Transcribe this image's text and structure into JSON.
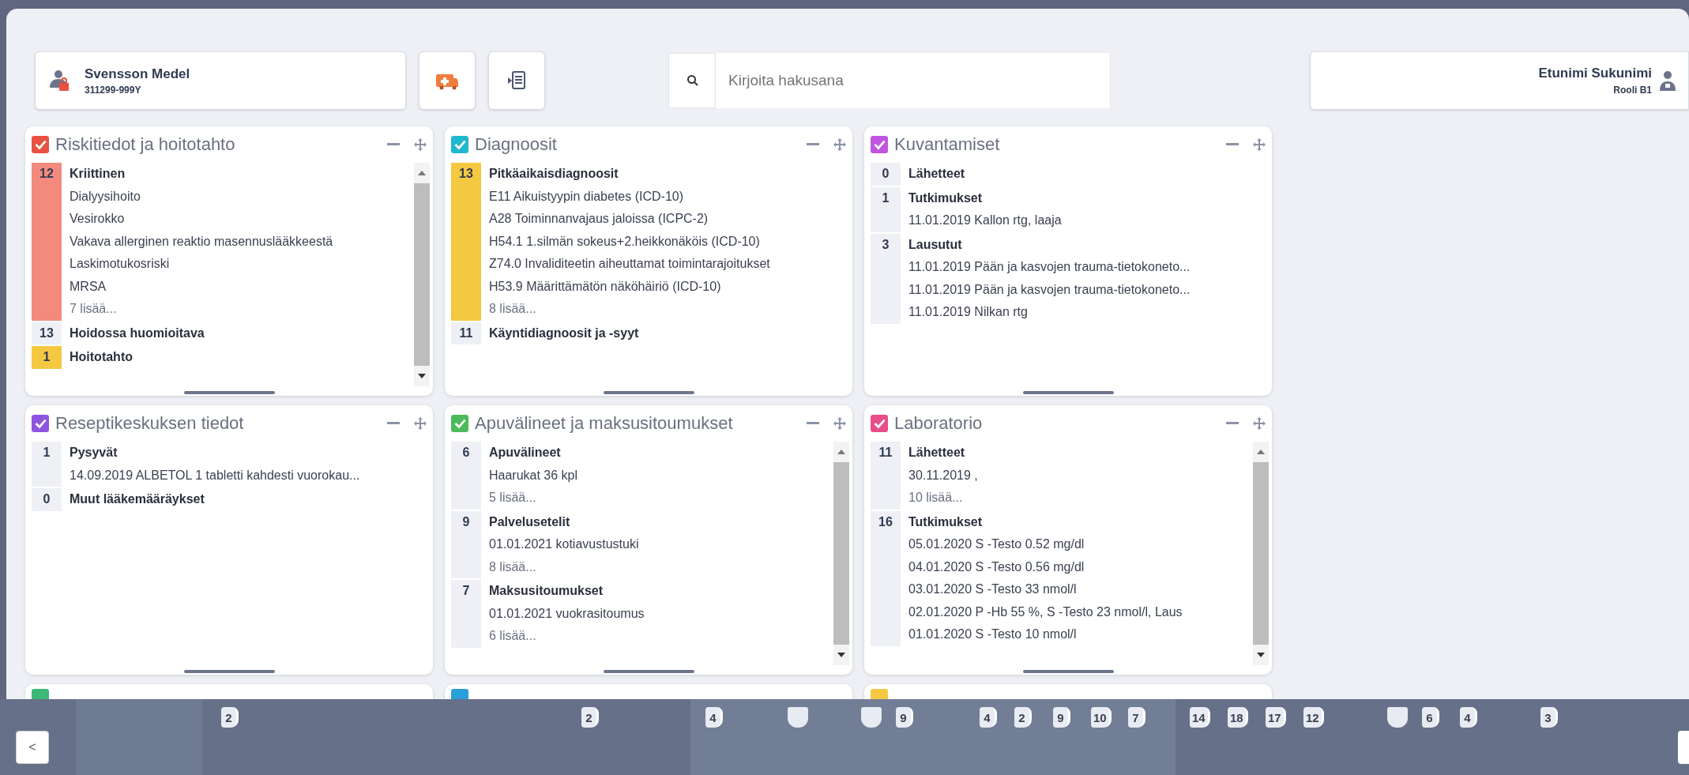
{
  "patient": {
    "name": "Svensson Medel",
    "id": "311299-999Y"
  },
  "search": {
    "placeholder": "Kirjoita hakusana"
  },
  "user": {
    "name": "Etunimi Sukunimi",
    "role": "Rooli B1"
  },
  "panels": [
    {
      "title": "Riskitiedot ja hoitotahto",
      "color": "#e8513f",
      "scroll": true,
      "groups": [
        {
          "count": "12",
          "color": "#f28b7e",
          "title": "Kriittinen",
          "items": [
            "Dialyysihoito",
            "Vesirokko",
            "Vakava allerginen reaktio masennuslääkkeestä",
            "Laskimotukosriski",
            "MRSA"
          ],
          "more": "7 lisää..."
        },
        {
          "count": "13",
          "color": "#eef0f5",
          "title": "Hoidossa huomioitava"
        },
        {
          "count": "1",
          "color": "#f5c842",
          "title": "Hoitotahto"
        }
      ]
    },
    {
      "title": "Diagnoosit",
      "color": "#20b8cf",
      "scroll": false,
      "groups": [
        {
          "count": "13",
          "color": "#f5c842",
          "title": "Pitkäaikaisdiagnoosit",
          "items": [
            "E11 Aikuistyypin diabetes (ICD-10)",
            "A28 Toiminnanvajaus jaloissa (ICPC-2)",
            "H54.1 1.silmän sokeus+2.heikkonäköis (ICD-10)",
            "Z74.0 Invaliditeetin aiheuttamat toimintarajoitukset",
            "H53.9 Määrittämätön näköhäiriö (ICD-10)"
          ],
          "more": "8 lisää..."
        },
        {
          "count": "11",
          "color": "#eef0f5",
          "title": "Käyntidiagnoosit ja -syyt"
        }
      ]
    },
    {
      "title": "Kuvantamiset",
      "color": "#c055e0",
      "scroll": false,
      "groups": [
        {
          "count": "0",
          "color": "#eef0f5",
          "title": "Lähetteet"
        },
        {
          "count": "1",
          "color": "#eef0f5",
          "title": "Tutkimukset",
          "items": [
            "11.01.2019 Kallon rtg, laaja"
          ]
        },
        {
          "count": "3",
          "color": "#eef0f5",
          "title": "Lausutut",
          "items": [
            "11.01.2019 Pään ja kasvojen trauma-tietokoneto...",
            "11.01.2019 Pään ja kasvojen trauma-tietokoneto...",
            "11.01.2019 Nilkan rtg"
          ]
        }
      ]
    },
    {
      "title": "Reseptikeskuksen tiedot",
      "color": "#8e54e0",
      "scroll": false,
      "groups": [
        {
          "count": "1",
          "color": "#eef0f5",
          "title": "Pysyvät",
          "items": [
            "14.09.2019 ALBETOL 1 tabletti kahdesti vuorokau..."
          ]
        },
        {
          "count": "0",
          "color": "#eef0f5",
          "title": "Muut lääkemääräykset"
        }
      ]
    },
    {
      "title": "Apuvälineet ja maksusitoumukset",
      "color": "#4cba5a",
      "scroll": true,
      "groups": [
        {
          "count": "6",
          "color": "#eef0f5",
          "title": "Apuvälineet",
          "items": [
            "Haarukat 36 kpl"
          ],
          "more": "5 lisää..."
        },
        {
          "count": "9",
          "color": "#eef0f5",
          "title": "Palvelusetelit",
          "items": [
            "01.01.2021 kotiavustustuki"
          ],
          "more": "8 lisää..."
        },
        {
          "count": "7",
          "color": "#eef0f5",
          "title": "Maksusitoumukset",
          "items": [
            "01.01.2021 vuokrasitoumus"
          ],
          "more": "6 lisää..."
        }
      ]
    },
    {
      "title": "Laboratorio",
      "color": "#e84d8a",
      "scroll": true,
      "groups": [
        {
          "count": "11",
          "color": "#eef0f5",
          "title": "Lähetteet",
          "items": [
            "30.11.2019 ,"
          ],
          "more": "10 lisää..."
        },
        {
          "count": "16",
          "color": "#eef0f5",
          "title": "Tutkimukset",
          "items": [
            "05.01.2020 S -Testo 0.52 mg/dl",
            "04.01.2020 S -Testo 0.56 mg/dl",
            "03.01.2020 S -Testo 33 nmol/l",
            "02.01.2020 P -Hb 55 %, S -Testo 23 nmol/l, Laus",
            "01.01.2020 S -Testo 10 nmol/l"
          ]
        }
      ]
    }
  ],
  "hidden_panels": [
    {
      "color": "#3cb878"
    },
    {
      "color": "#2a9fd8"
    },
    {
      "color": "#f5c842"
    }
  ],
  "timeline": {
    "back": "<",
    "markers": [
      {
        "kind": "count",
        "label": "2"
      },
      {
        "kind": "count",
        "label": "2"
      },
      {
        "kind": "count",
        "label": "4"
      },
      {
        "kind": "empty"
      },
      {
        "kind": "empty"
      },
      {
        "kind": "count",
        "label": "9"
      },
      {
        "kind": "count",
        "label": "4"
      },
      {
        "kind": "count",
        "label": "2"
      },
      {
        "kind": "count",
        "label": "9"
      },
      {
        "kind": "count",
        "label": "10"
      },
      {
        "kind": "count",
        "label": "7"
      },
      {
        "kind": "count",
        "label": "14"
      },
      {
        "kind": "count",
        "label": "18"
      },
      {
        "kind": "count",
        "label": "17"
      },
      {
        "kind": "count",
        "label": "12"
      },
      {
        "kind": "empty"
      },
      {
        "kind": "count",
        "label": "6"
      },
      {
        "kind": "count",
        "label": "4"
      },
      {
        "kind": "count",
        "label": "3"
      }
    ]
  }
}
